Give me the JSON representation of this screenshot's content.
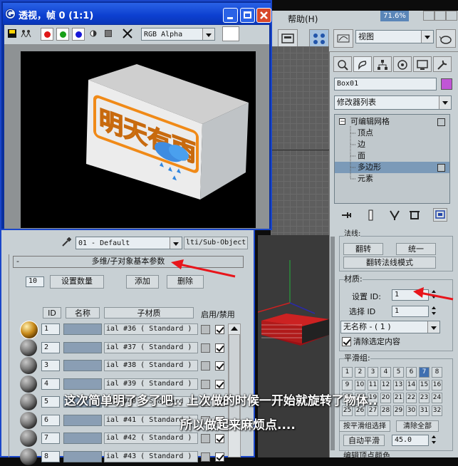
{
  "render_window": {
    "title": "透视，帧 0 (1:1)",
    "channel_select": "RGB Alpha",
    "render_text": "明天有雨"
  },
  "max_menubar": {
    "help_menu": "帮助(H)",
    "perf_indicator": "71.6%"
  },
  "max_toolbar": {
    "view_dropdown": "视图"
  },
  "command_panel": {
    "object_name": "Box01",
    "object_color": "#c155d6",
    "modifier_list": "修改器列表",
    "stack": [
      {
        "label": "可编辑网格",
        "expanded": "minus",
        "selected": false
      },
      {
        "label": "顶点",
        "selected": false
      },
      {
        "label": "边",
        "selected": false
      },
      {
        "label": "面",
        "selected": false
      },
      {
        "label": "多边形",
        "selected": true
      },
      {
        "label": "元素",
        "selected": false
      }
    ],
    "normals_group_label": "法线:",
    "flip_button": "翻转",
    "unify_button": "统一",
    "flip_normal_mode_button": "翻转法线模式",
    "material_group_label": "材质:",
    "set_id_label": "设置 ID:",
    "set_id_value": "1",
    "select_id_label": "选择 ID",
    "select_id_value": "1",
    "name_dropdown": "无名称 - ( 1 )",
    "clear_selection_label": "清除选定内容",
    "clear_selection_checked": true,
    "smoothing_group_label": "平滑组:",
    "smoothing_numbers": [
      "1",
      "2",
      "3",
      "4",
      "5",
      "6",
      "7",
      "8",
      "9",
      "10",
      "11",
      "12",
      "13",
      "14",
      "15",
      "16",
      "17",
      "18",
      "19",
      "20",
      "21",
      "22",
      "23",
      "24",
      "25",
      "26",
      "27",
      "28",
      "29",
      "30",
      "31",
      "32"
    ],
    "smoothing_active": "7",
    "select_by_smooth_button": "按平滑组选择",
    "clear_all_button": "清除全部",
    "auto_smooth_button": "自动平滑",
    "auto_smooth_value": "45.0",
    "edit_vertex_colors": "编辑顶点颜色"
  },
  "material_editor": {
    "material_name": "01 - Default",
    "material_type": "lti/Sub-Object",
    "rollout_title": "多维/子对象基本参数",
    "rollout_minus": "-",
    "count_value": "10",
    "set_count_button": "设置数量",
    "add_button": "添加",
    "delete_button": "删除",
    "col_id": "ID",
    "col_name": "名称",
    "col_submaterial": "子材质",
    "col_onoff": "启用/禁用",
    "rows": [
      {
        "id": "1",
        "sub": "ial #36   ( Standard )",
        "checked": true,
        "gold": true
      },
      {
        "id": "2",
        "sub": "ial #37   ( Standard )",
        "checked": true,
        "gold": false
      },
      {
        "id": "3",
        "sub": "ial #38   ( Standard )",
        "checked": true,
        "gold": false
      },
      {
        "id": "4",
        "sub": "ial #39   ( Standard )",
        "checked": true,
        "gold": false
      },
      {
        "id": "5",
        "sub": "ial #40   ( Standard )",
        "checked": true,
        "gold": false
      },
      {
        "id": "6",
        "sub": "ial #41   ( Standard )",
        "checked": true,
        "gold": false
      },
      {
        "id": "7",
        "sub": "ial #42   ( Standard )",
        "checked": true,
        "gold": false
      },
      {
        "id": "8",
        "sub": "ial #43   ( Standard )",
        "checked": true,
        "gold": false
      }
    ]
  },
  "captions": {
    "line1": "这次简单明了多了吧..  上次做的时候一开始就旋转了物体..",
    "line2": "所以做起来麻烦点...."
  },
  "colors": {
    "title_blue": "#0c3fd0",
    "panel_gray": "#c8d0d4",
    "selection_blue": "#7b9ab8",
    "annotation_red": "#e8151b"
  }
}
